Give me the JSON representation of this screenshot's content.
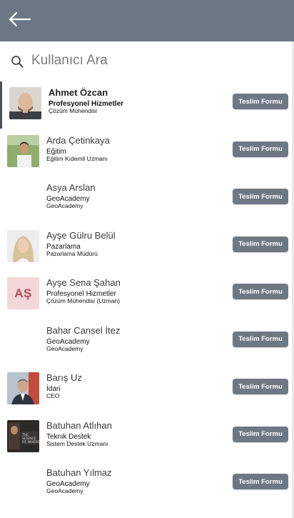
{
  "header": {
    "back_icon": "arrow-left-icon",
    "color": "#6b7785"
  },
  "search": {
    "placeholder": "Kullanıcı Ara",
    "icon": "search-icon"
  },
  "button_color": "#6e7885",
  "users": [
    {
      "name": "Ahmet Özcan",
      "department": "Profesyonel Hizmetler",
      "title": "Çözüm Mühendisi",
      "button": "Teslim Formu",
      "avatar": "photo"
    },
    {
      "name": "Arda Çetinkaya",
      "department": "Eğitim",
      "title": "Eğitim Kıdemli Uzmanı",
      "button": "Teslim Formu",
      "avatar": "photo"
    },
    {
      "name": "Asya Arslan",
      "department": "GeoAcademy",
      "title": "GeoAcademy",
      "button": "Teslim Formu",
      "avatar": "none"
    },
    {
      "name": "Ayşe Gülru Belül",
      "department": "Pazarlama",
      "title": "Pazarlama Müdürü",
      "button": "Teslim Formu",
      "avatar": "photo"
    },
    {
      "name": "Ayşe Sena Şahan",
      "department": "Profesyonel Hizmetler",
      "title": "Çözüm Mühendisi (Uzman)",
      "button": "Teslim Formu",
      "avatar": "initials",
      "initials": "AŞ"
    },
    {
      "name": "Bahar Cansel İtez",
      "department": "GeoAcademy",
      "title": "GeoAcademy",
      "button": "Teslim Formu",
      "avatar": "none"
    },
    {
      "name": "Barış Uz",
      "department": "İdari",
      "title": "CEO",
      "button": "Teslim Formu",
      "avatar": "photo"
    },
    {
      "name": "Batuhan Atlıhan",
      "department": "Teknik Destek",
      "title": "Sistem Destek Uzmanı",
      "button": "Teslim Formu",
      "avatar": "photo"
    },
    {
      "name": "Batuhan Yılmaz",
      "department": "GeoAcademy",
      "title": "GeoAcademy",
      "button": "Teslim Formu",
      "avatar": "none"
    }
  ]
}
